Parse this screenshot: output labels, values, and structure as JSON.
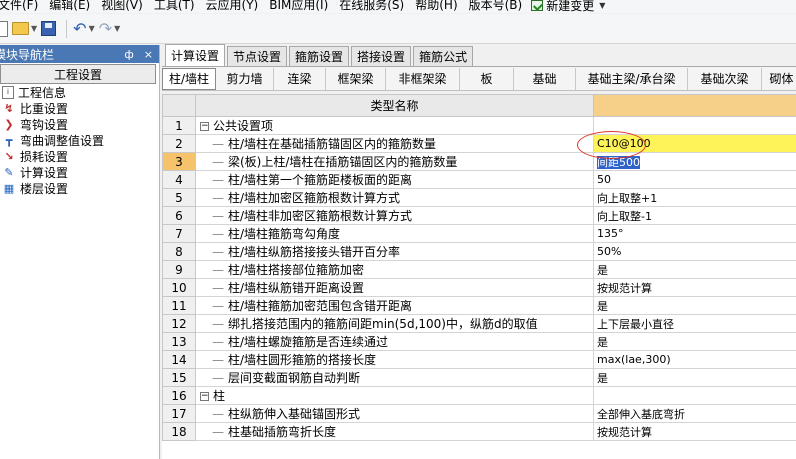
{
  "menubar": {
    "items": [
      "文件(F)",
      "编辑(E)",
      "视图(V)",
      "工具(T)",
      "云应用(Y)",
      "BIM应用(I)",
      "在线服务(S)",
      "帮助(H)",
      "版本号(B)"
    ],
    "new_change": "新建变更"
  },
  "toolbar": {
    "icons": [
      "new-file-icon",
      "open-folder-icon",
      "save-icon",
      "undo-icon",
      "redo-icon"
    ]
  },
  "left_panel": {
    "title": "模块导航栏",
    "pin_glyph": "ф",
    "close_glyph": "×",
    "header": "工程设置",
    "items": [
      {
        "label": "工程信息",
        "icon": "info-icon"
      },
      {
        "label": "比重设置",
        "icon": "weight-icon"
      },
      {
        "label": "弯钩设置",
        "icon": "hook-icon"
      },
      {
        "label": "弯曲调整值设置",
        "icon": "bend-icon"
      },
      {
        "label": "损耗设置",
        "icon": "loss-icon"
      },
      {
        "label": "计算设置",
        "icon": "calc-icon",
        "selected": true
      },
      {
        "label": "楼层设置",
        "icon": "floor-icon"
      }
    ]
  },
  "tabs_primary": [
    "计算设置",
    "节点设置",
    "箍筋设置",
    "搭接设置",
    "箍筋公式"
  ],
  "tabs_secondary": [
    "柱/墙柱",
    "剪力墙",
    "连梁",
    "框架梁",
    "非框架梁",
    "板",
    "基础",
    "基础主梁/承台梁",
    "基础次梁",
    "砌体"
  ],
  "grid": {
    "header_name": "类型名称",
    "header_value": "",
    "rows": [
      {
        "num": "1",
        "type": "group",
        "name": "公共设置项",
        "value": ""
      },
      {
        "num": "2",
        "type": "item",
        "name": "柱/墙柱在基础插筋锚固区内的箍筋数量",
        "value": "C10@100"
      },
      {
        "num": "3",
        "type": "item",
        "name": "梁(板)上柱/墙柱在插筋锚固区内的箍筋数量",
        "value": "间距500"
      },
      {
        "num": "4",
        "type": "item",
        "name": "柱/墙柱第一个箍筋距楼板面的距离",
        "value": "50"
      },
      {
        "num": "5",
        "type": "item",
        "name": "柱/墙柱加密区箍筋根数计算方式",
        "value": "向上取整+1"
      },
      {
        "num": "6",
        "type": "item",
        "name": "柱/墙柱非加密区箍筋根数计算方式",
        "value": "向上取整-1"
      },
      {
        "num": "7",
        "type": "item",
        "name": "柱/墙柱箍筋弯勾角度",
        "value": "135°"
      },
      {
        "num": "8",
        "type": "item",
        "name": "柱/墙柱纵筋搭接接头错开百分率",
        "value": "50%"
      },
      {
        "num": "9",
        "type": "item",
        "name": "柱/墙柱搭接部位箍筋加密",
        "value": "是"
      },
      {
        "num": "10",
        "type": "item",
        "name": "柱/墙柱纵筋错开距离设置",
        "value": "按规范计算"
      },
      {
        "num": "11",
        "type": "item",
        "name": "柱/墙柱箍筋加密范围包含错开距离",
        "value": "是"
      },
      {
        "num": "12",
        "type": "item",
        "name": "绑扎搭接范围内的箍筋间距min(5d,100)中，纵筋d的取值",
        "value": "上下层最小直径"
      },
      {
        "num": "13",
        "type": "item",
        "name": "柱/墙柱螺旋箍筋是否连续通过",
        "value": "是"
      },
      {
        "num": "14",
        "type": "item",
        "name": "柱/墙柱圆形箍筋的搭接长度",
        "value": "max(lae,300)"
      },
      {
        "num": "15",
        "type": "item",
        "name": "层间变截面钢筋自动判断",
        "value": "是"
      },
      {
        "num": "16",
        "type": "group",
        "name": "柱",
        "value": ""
      },
      {
        "num": "17",
        "type": "item",
        "name": "柱纵筋伸入基础锚固形式",
        "value": "全部伸入基底弯折"
      },
      {
        "num": "18",
        "type": "item",
        "name": "柱基础插筋弯折长度",
        "value": "按规范计算"
      }
    ]
  },
  "colors": {
    "panel_title": "#4a78b5",
    "header_value_bg": "#f6d089",
    "active_value_bg": "#fff35a",
    "row_highlight": "#f6c26a",
    "selection": "#2f63c9",
    "annotation": "#e0342a"
  }
}
